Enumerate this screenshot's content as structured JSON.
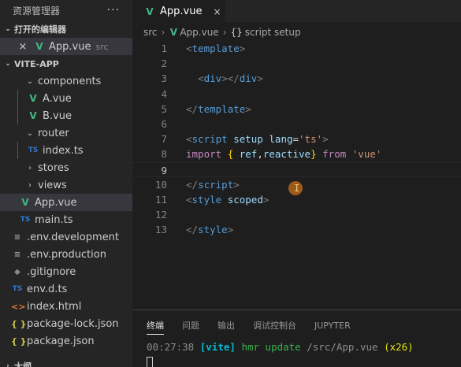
{
  "explorer": {
    "title": "资源管理器",
    "more": "···",
    "open_editors": {
      "title": "打开的编辑器",
      "items": [
        {
          "name": "App.vue",
          "folder": "src"
        }
      ]
    },
    "project": {
      "title": "VITE-APP",
      "items": [
        {
          "name": "components",
          "type": "folder",
          "depth": 1,
          "expanded": true
        },
        {
          "name": "A.vue",
          "type": "vue",
          "depth": 2
        },
        {
          "name": "B.vue",
          "type": "vue",
          "depth": 2
        },
        {
          "name": "router",
          "type": "folder",
          "depth": 1,
          "expanded": true
        },
        {
          "name": "index.ts",
          "type": "ts",
          "depth": 2
        },
        {
          "name": "stores",
          "type": "folder",
          "depth": 1,
          "expanded": false
        },
        {
          "name": "views",
          "type": "folder",
          "depth": 1,
          "expanded": false
        },
        {
          "name": "App.vue",
          "type": "vue",
          "depth": 1,
          "selected": true
        },
        {
          "name": "main.ts",
          "type": "ts",
          "depth": 1
        },
        {
          "name": ".env.development",
          "type": "env",
          "depth": 0
        },
        {
          "name": ".env.production",
          "type": "env",
          "depth": 0
        },
        {
          "name": ".gitignore",
          "type": "git",
          "depth": 0
        },
        {
          "name": "env.d.ts",
          "type": "ts",
          "depth": 0
        },
        {
          "name": "index.html",
          "type": "html",
          "depth": 0
        },
        {
          "name": "package-lock.json",
          "type": "json",
          "depth": 0
        },
        {
          "name": "package.json",
          "type": "json",
          "depth": 0
        }
      ],
      "outline_title": "大纲"
    }
  },
  "icons": {
    "vue": "V",
    "ts": "TS",
    "json": "{ }",
    "html": "<>",
    "git": "◆",
    "env": "≡",
    "close": "×",
    "chevron_down": "⌄",
    "chevron_right": "›"
  },
  "editor": {
    "tab": {
      "label": "App.vue",
      "close": "×"
    },
    "breadcrumb": {
      "root": "src",
      "file": "App.vue",
      "symbol_brace": "{}",
      "symbol": "script setup"
    },
    "active_line": 9,
    "lines": [
      {
        "n": "1",
        "tokens": [
          [
            "pu",
            "<"
          ],
          [
            "tg",
            "template"
          ],
          [
            "pu",
            ">"
          ]
        ]
      },
      {
        "n": "2",
        "tokens": []
      },
      {
        "n": "3",
        "tokens": [
          [
            "tx",
            "  "
          ],
          [
            "pu",
            "<"
          ],
          [
            "tg",
            "div"
          ],
          [
            "pu",
            "></"
          ],
          [
            "tg",
            "div"
          ],
          [
            "pu",
            ">"
          ]
        ]
      },
      {
        "n": "4",
        "tokens": []
      },
      {
        "n": "5",
        "tokens": [
          [
            "pu",
            "</"
          ],
          [
            "tg",
            "template"
          ],
          [
            "pu",
            ">"
          ]
        ]
      },
      {
        "n": "6",
        "tokens": []
      },
      {
        "n": "7",
        "tokens": [
          [
            "pu",
            "<"
          ],
          [
            "tg",
            "script"
          ],
          [
            "tx",
            " "
          ],
          [
            "at",
            "setup"
          ],
          [
            "tx",
            " "
          ],
          [
            "at",
            "lang"
          ],
          [
            "tx",
            "="
          ],
          [
            "st",
            "'ts'"
          ],
          [
            "pu",
            ">"
          ]
        ]
      },
      {
        "n": "8",
        "tokens": [
          [
            "kw",
            "import"
          ],
          [
            "tx",
            " "
          ],
          [
            "br",
            "{"
          ],
          [
            "tx",
            " "
          ],
          [
            "id",
            "ref"
          ],
          [
            "tx",
            ","
          ],
          [
            "id",
            "reactive"
          ],
          [
            "br",
            "}"
          ],
          [
            "tx",
            " "
          ],
          [
            "kw",
            "from"
          ],
          [
            "tx",
            " "
          ],
          [
            "st",
            "'vue'"
          ]
        ]
      },
      {
        "n": "9",
        "tokens": []
      },
      {
        "n": "10",
        "tokens": [
          [
            "pu",
            "</"
          ],
          [
            "tg",
            "script"
          ],
          [
            "pu",
            ">"
          ]
        ]
      },
      {
        "n": "11",
        "tokens": [
          [
            "pu",
            "<"
          ],
          [
            "tg",
            "style"
          ],
          [
            "tx",
            " "
          ],
          [
            "at",
            "scoped"
          ],
          [
            "pu",
            ">"
          ]
        ]
      },
      {
        "n": "12",
        "tokens": []
      },
      {
        "n": "13",
        "tokens": [
          [
            "pu",
            "</"
          ],
          [
            "tg",
            "style"
          ],
          [
            "pu",
            ">"
          ]
        ]
      }
    ]
  },
  "panel": {
    "tabs": [
      "终端",
      "问题",
      "输出",
      "调试控制台",
      "JUPYTER"
    ],
    "active_tab": 0,
    "terminal": {
      "time": "00:27:38",
      "tag": "[vite]",
      "message": "hmr update",
      "path": "/src/App.vue",
      "count": "(x26)"
    }
  },
  "colors": {
    "vue_green": "#41b883",
    "ts_blue": "#3178c6",
    "json_yellow": "#cbcb41",
    "html_orange": "#e37933",
    "sidebar_bg": "#252526",
    "editor_bg": "#1e1e1e",
    "selection_bg": "#37373d"
  }
}
